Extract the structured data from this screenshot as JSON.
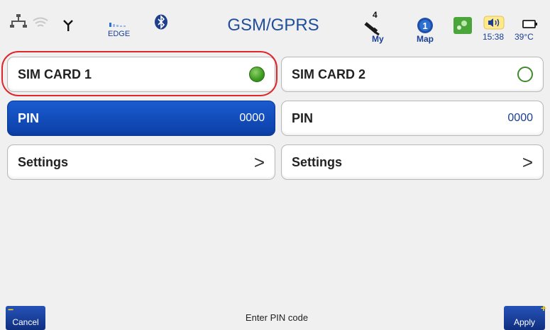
{
  "header": {
    "title": "GSM/GPRS",
    "network_label": "EDGE",
    "gps_label": "My",
    "gps_count": "4",
    "map_label": "Map",
    "time": "15:38",
    "temperature": "39°C"
  },
  "sim1": {
    "card_label": "SIM CARD 1",
    "pin_label": "PIN",
    "pin_value": "0000",
    "settings_label": "Settings",
    "chevron": ">",
    "active": true
  },
  "sim2": {
    "card_label": "SIM CARD 2",
    "pin_label": "PIN",
    "pin_value": "0000",
    "settings_label": "Settings",
    "chevron": ">",
    "active": false
  },
  "footer": {
    "cancel_label": "Cancel",
    "hint": "Enter PIN code",
    "apply_label": "Apply"
  },
  "colors": {
    "accent": "#1a5bd0",
    "title": "#1f4e9a",
    "highlight": "#e0262a",
    "active_led": "#3b9a1f"
  },
  "icons": [
    "ethernet-icon",
    "wifi-icon",
    "antenna-icon",
    "signal-bars-icon",
    "bluetooth-icon",
    "gps-satellite-icon",
    "map-icon",
    "network-icon",
    "speaker-icon",
    "battery-icon"
  ]
}
